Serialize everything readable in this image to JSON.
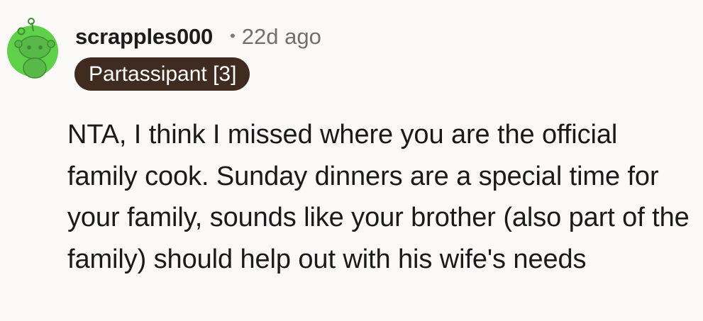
{
  "comment": {
    "author": "scrapples000",
    "separator": "•",
    "timestamp": "22d ago",
    "flair": "Partassipant [3]",
    "body": "NTA, I think I missed where you are the official family cook. Sunday dinners are a special time for your family, sounds like your brother (also part of the family) should help out with his wife's needs"
  },
  "colors": {
    "background": "#faf9f8",
    "avatar_green": "#5fd04a",
    "flair_background": "#3f2b20",
    "flair_text": "#ffffff",
    "meta_text": "#6f6f6f"
  },
  "icons": {
    "avatar": "snoo-avatar-icon"
  }
}
